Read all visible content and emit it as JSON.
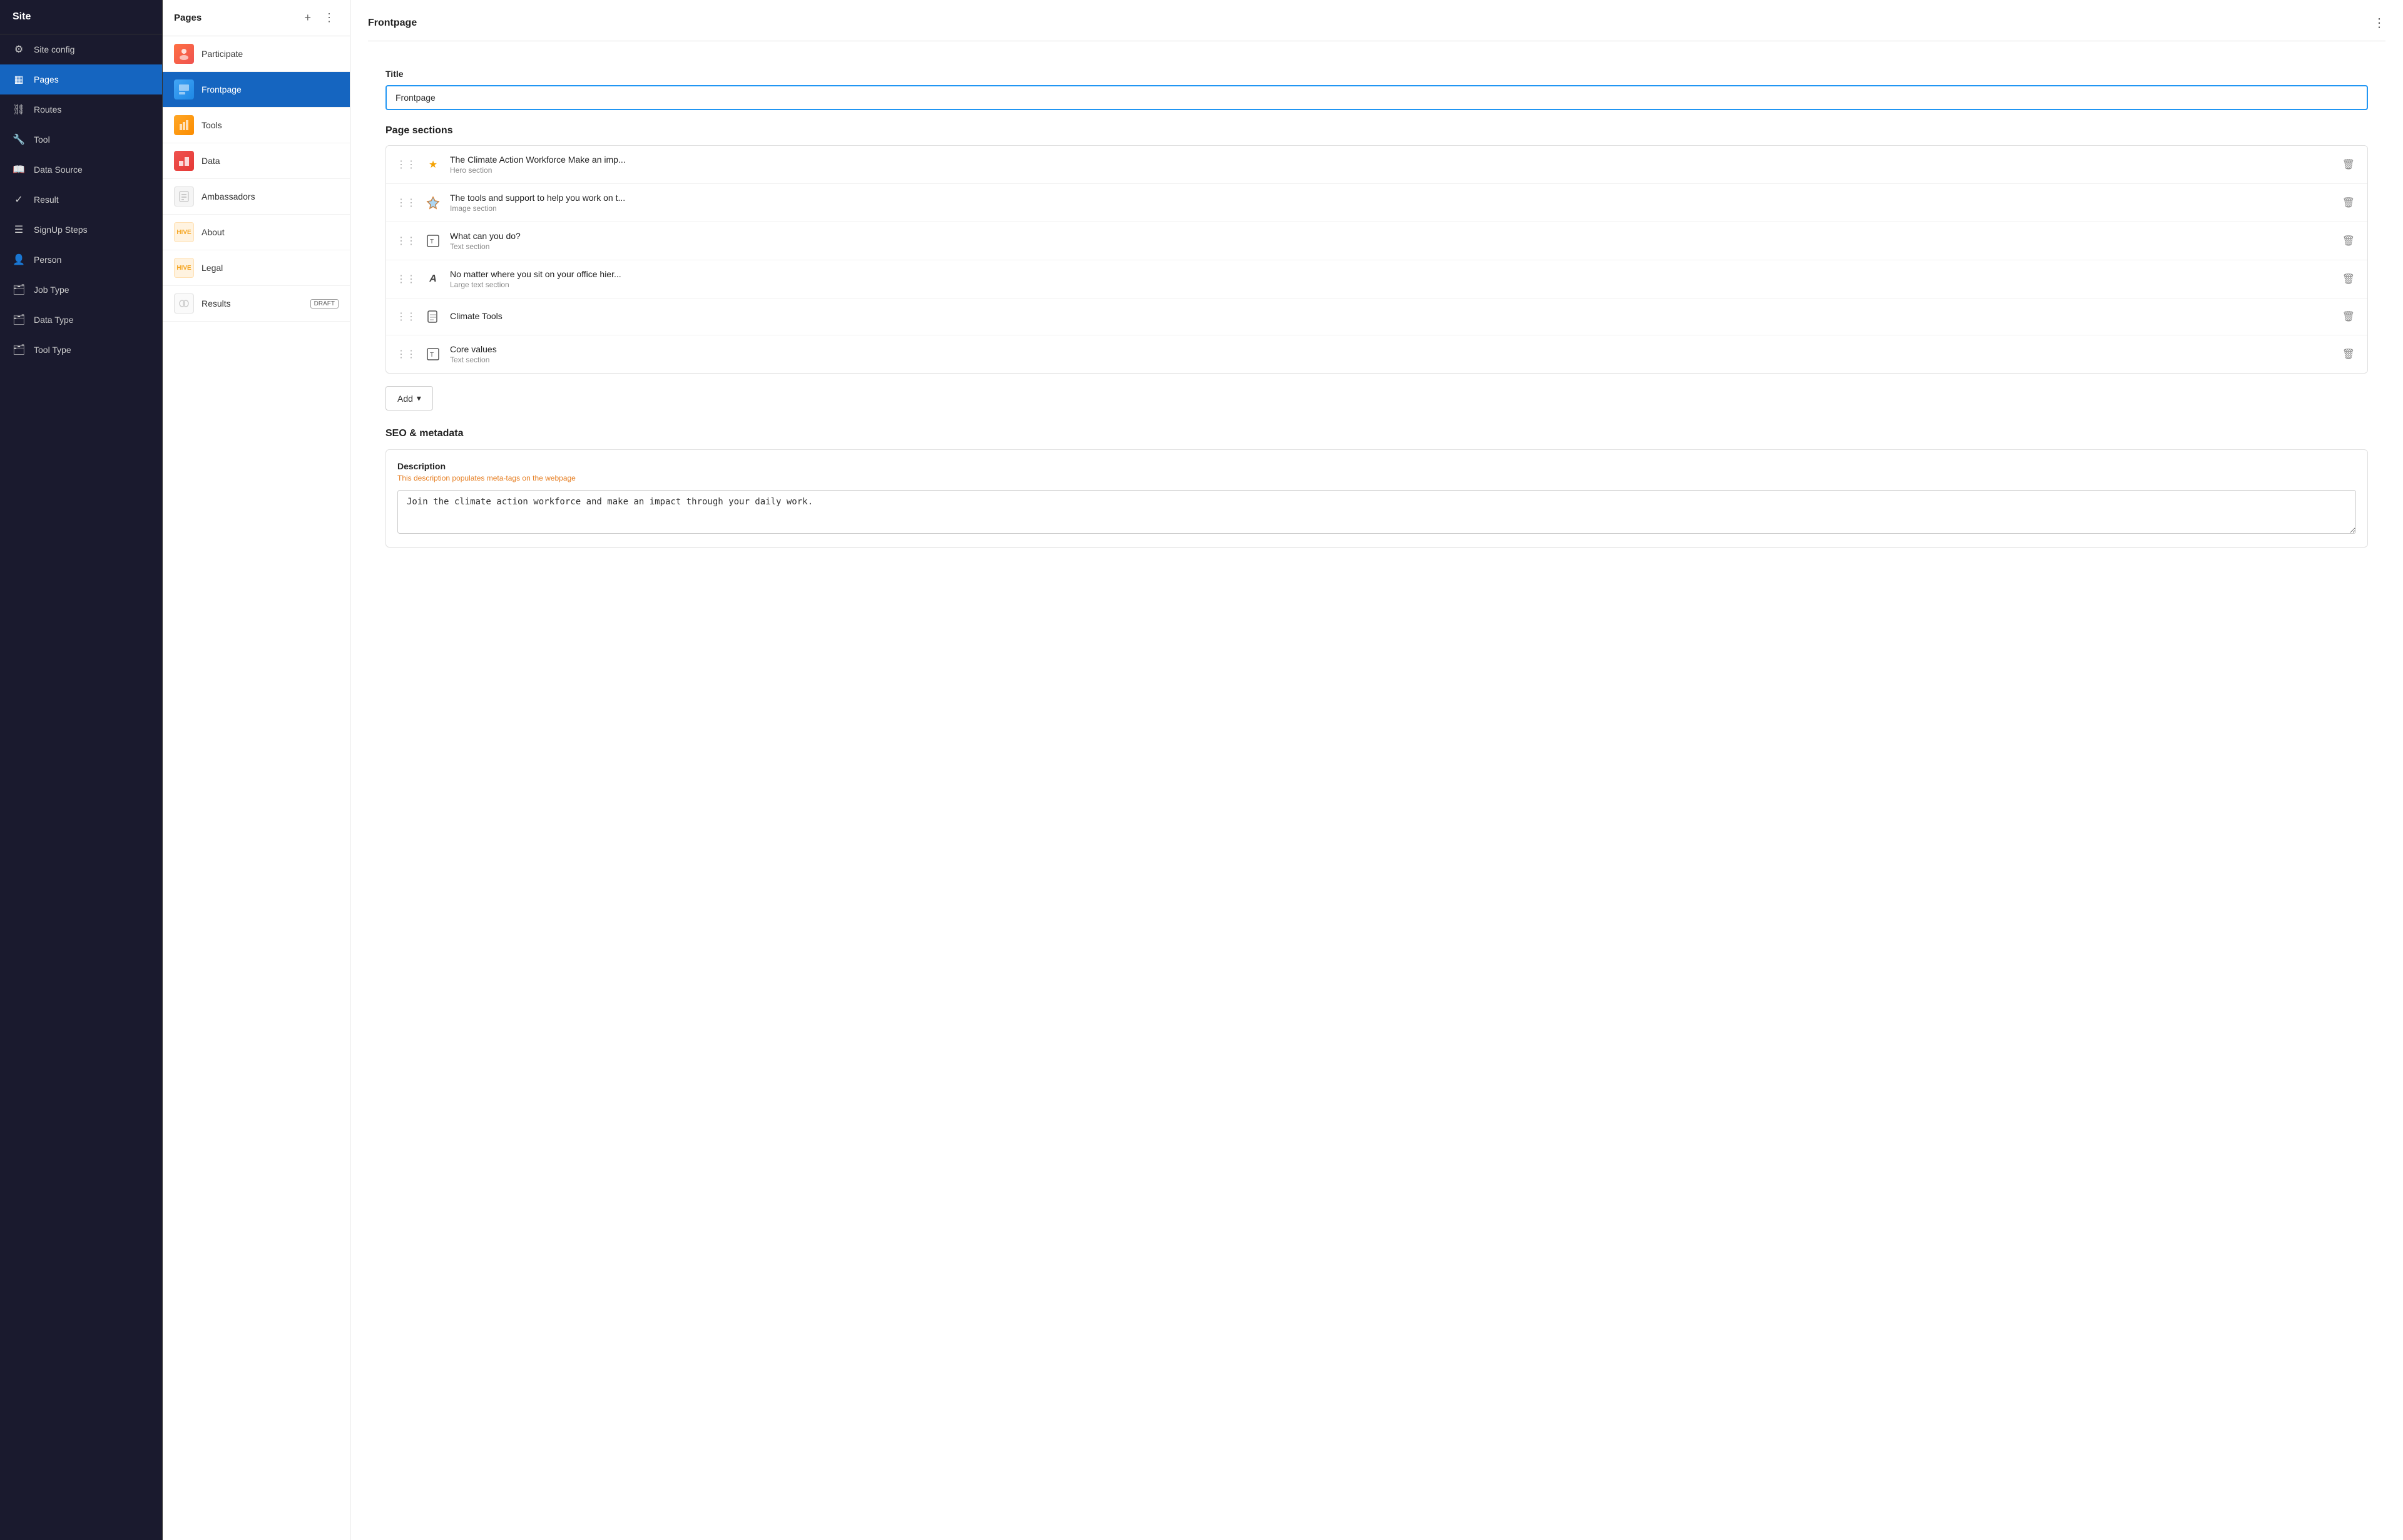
{
  "sidebar": {
    "title": "Site",
    "items": [
      {
        "id": "site-config",
        "label": "Site config",
        "icon": "⚙",
        "active": false
      },
      {
        "id": "pages",
        "label": "Pages",
        "icon": "▦",
        "active": true
      },
      {
        "id": "routes",
        "label": "Routes",
        "icon": "🔗",
        "active": false
      },
      {
        "id": "tool",
        "label": "Tool",
        "icon": "🔧",
        "active": false
      },
      {
        "id": "data-source",
        "label": "Data Source",
        "icon": "📚",
        "active": false
      },
      {
        "id": "result",
        "label": "Result",
        "icon": "✓",
        "active": false
      },
      {
        "id": "signup-steps",
        "label": "SignUp Steps",
        "icon": "≡",
        "active": false
      },
      {
        "id": "person",
        "label": "Person",
        "icon": "👤",
        "active": false
      },
      {
        "id": "job-type",
        "label": "Job Type",
        "icon": "🗂",
        "active": false
      },
      {
        "id": "data-type",
        "label": "Data Type",
        "icon": "🗂",
        "active": false
      },
      {
        "id": "tool-type",
        "label": "Tool Type",
        "icon": "🗂",
        "active": false
      }
    ]
  },
  "pages_panel": {
    "title": "Pages",
    "add_label": "+",
    "menu_label": "⋮",
    "items": [
      {
        "id": "participate",
        "label": "Participate",
        "thumb_type": "participate",
        "draft": false,
        "active": false
      },
      {
        "id": "frontpage",
        "label": "Frontpage",
        "thumb_type": "frontpage",
        "draft": false,
        "active": true
      },
      {
        "id": "tools",
        "label": "Tools",
        "thumb_type": "tools",
        "draft": false,
        "active": false
      },
      {
        "id": "data",
        "label": "Data",
        "thumb_type": "data",
        "draft": false,
        "active": false
      },
      {
        "id": "ambassadors",
        "label": "Ambassadors",
        "thumb_type": "ambassadors",
        "draft": false,
        "active": false
      },
      {
        "id": "about",
        "label": "About",
        "thumb_type": "about",
        "draft": false,
        "active": false
      },
      {
        "id": "legal",
        "label": "Legal",
        "thumb_type": "legal",
        "draft": false,
        "active": false
      },
      {
        "id": "results",
        "label": "Results",
        "thumb_type": "results",
        "draft": true,
        "active": false
      }
    ]
  },
  "main": {
    "header_title": "Frontpage",
    "menu_label": "⋮",
    "title_label": "Title",
    "title_value": "Frontpage",
    "page_sections_label": "Page sections",
    "sections": [
      {
        "id": "hero",
        "name": "The Climate Action Workforce Make an imp...",
        "type": "Hero section",
        "icon": "★",
        "icon_type": "star"
      },
      {
        "id": "tools-support",
        "name": "The tools and support to help you work on t...",
        "type": "Image section",
        "icon": "◆",
        "icon_type": "diamond-color"
      },
      {
        "id": "what-can",
        "name": "What can you do?",
        "type": "Text section",
        "icon": "⊡",
        "icon_type": "box"
      },
      {
        "id": "no-matter",
        "name": "No matter where you sit on your office hier...",
        "type": "Large text section",
        "icon": "A",
        "icon_type": "text-a"
      },
      {
        "id": "climate-tools",
        "name": "Climate Tools",
        "type": "",
        "icon": "📄",
        "icon_type": "document"
      },
      {
        "id": "core-values",
        "name": "Core values",
        "type": "Text section",
        "icon": "⊡",
        "icon_type": "box"
      }
    ],
    "add_button_label": "Add",
    "add_chevron": "▾",
    "seo_title": "SEO & metadata",
    "seo": {
      "description_label": "Description",
      "description_hint": "This description populates meta-tags on the webpage",
      "description_value": "Join the climate action workforce and make an impact through your daily work."
    }
  }
}
